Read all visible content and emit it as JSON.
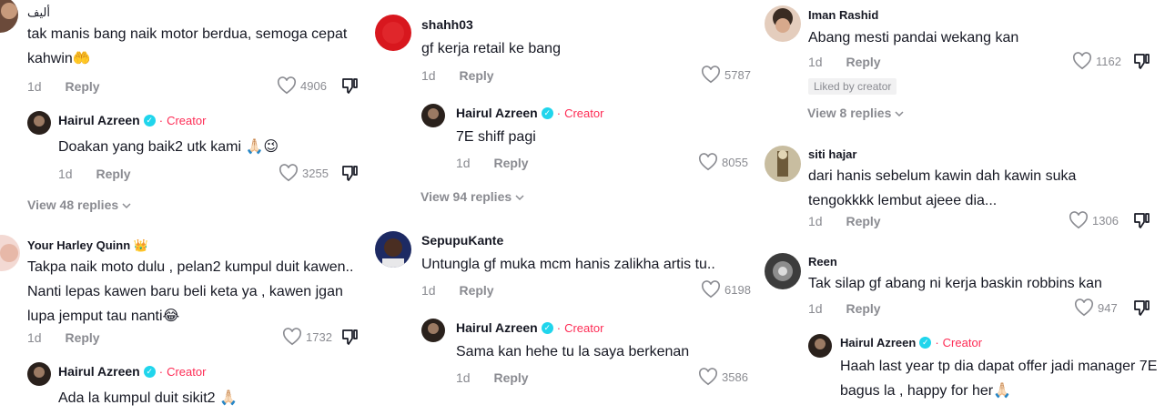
{
  "col1": {
    "c1": {
      "username": "أليف",
      "text": "tak manis bang naik motor berdua, semoga cepat kahwin🤲",
      "time": "1d",
      "reply": "Reply",
      "likes": "4906"
    },
    "r1": {
      "username": "Hairul Azreen",
      "dot": "·",
      "creator": "Creator",
      "text": "Doakan yang baik2 utk kami 🙏🏻😉",
      "time": "1d",
      "reply": "Reply",
      "likes": "3255"
    },
    "view1": "View 48 replies",
    "c2": {
      "username": "Your Harley Quinn 👑",
      "text": "Takpa naik moto dulu , pelan2 kumpul duit kawen.. Nanti lepas kawen baru beli keta ya , kawen jgan lupa jemput tau nanti😂",
      "time": "1d",
      "reply": "Reply",
      "likes": "1732"
    },
    "r2": {
      "username": "Hairul Azreen",
      "dot": "·",
      "creator": "Creator",
      "text": "Ada la kumpul duit sikit2 🙏🏻"
    }
  },
  "col2": {
    "c1": {
      "username": "shahh03",
      "text": "gf kerja retail ke bang",
      "time": "1d",
      "reply": "Reply",
      "likes": "5787"
    },
    "r1": {
      "username": "Hairul Azreen",
      "dot": "·",
      "creator": "Creator",
      "text": "7E shiff pagi",
      "time": "1d",
      "reply": "Reply",
      "likes": "8055"
    },
    "view1": "View 94 replies",
    "c2": {
      "username": "SepupuKante",
      "text": "Untungla gf muka mcm hanis zalikha artis tu..",
      "time": "1d",
      "reply": "Reply",
      "likes": "6198"
    },
    "r2": {
      "username": "Hairul Azreen",
      "dot": "·",
      "creator": "Creator",
      "text": "Sama kan hehe tu la saya berkenan",
      "time": "1d",
      "reply": "Reply",
      "likes": "3586"
    }
  },
  "col3": {
    "c1": {
      "username": "Iman Rashid",
      "text": "Abang mesti pandai wekang kan",
      "time": "1d",
      "reply": "Reply",
      "likes": "1162",
      "liked_by": "Liked by creator"
    },
    "view1": "View 8 replies",
    "c2": {
      "username": "siti hajar",
      "text": "dari hanis sebelum kawin dah kawin suka tengokkkk lembut ajeee dia...",
      "time": "1d",
      "reply": "Reply",
      "likes": "1306"
    },
    "c3": {
      "username": "Reen",
      "text": "Tak silap gf abang ni kerja baskin robbins kan",
      "time": "1d",
      "reply": "Reply",
      "likes": "947"
    },
    "r1": {
      "username": "Hairul Azreen",
      "dot": "·",
      "creator": "Creator",
      "text": "Haah last year tp dia dapat offer jadi manager 7E bagus la , happy for her🙏🏻"
    }
  },
  "icons": {
    "heart": "heart-icon",
    "dislike": "thumbs-down-icon",
    "chevron": "chevron-down-icon",
    "verified": "verified-badge-icon"
  },
  "colors": {
    "creator": "#fe2c55",
    "verified": "#20d5ec",
    "muted": "#8a8b91",
    "text": "#161823"
  }
}
